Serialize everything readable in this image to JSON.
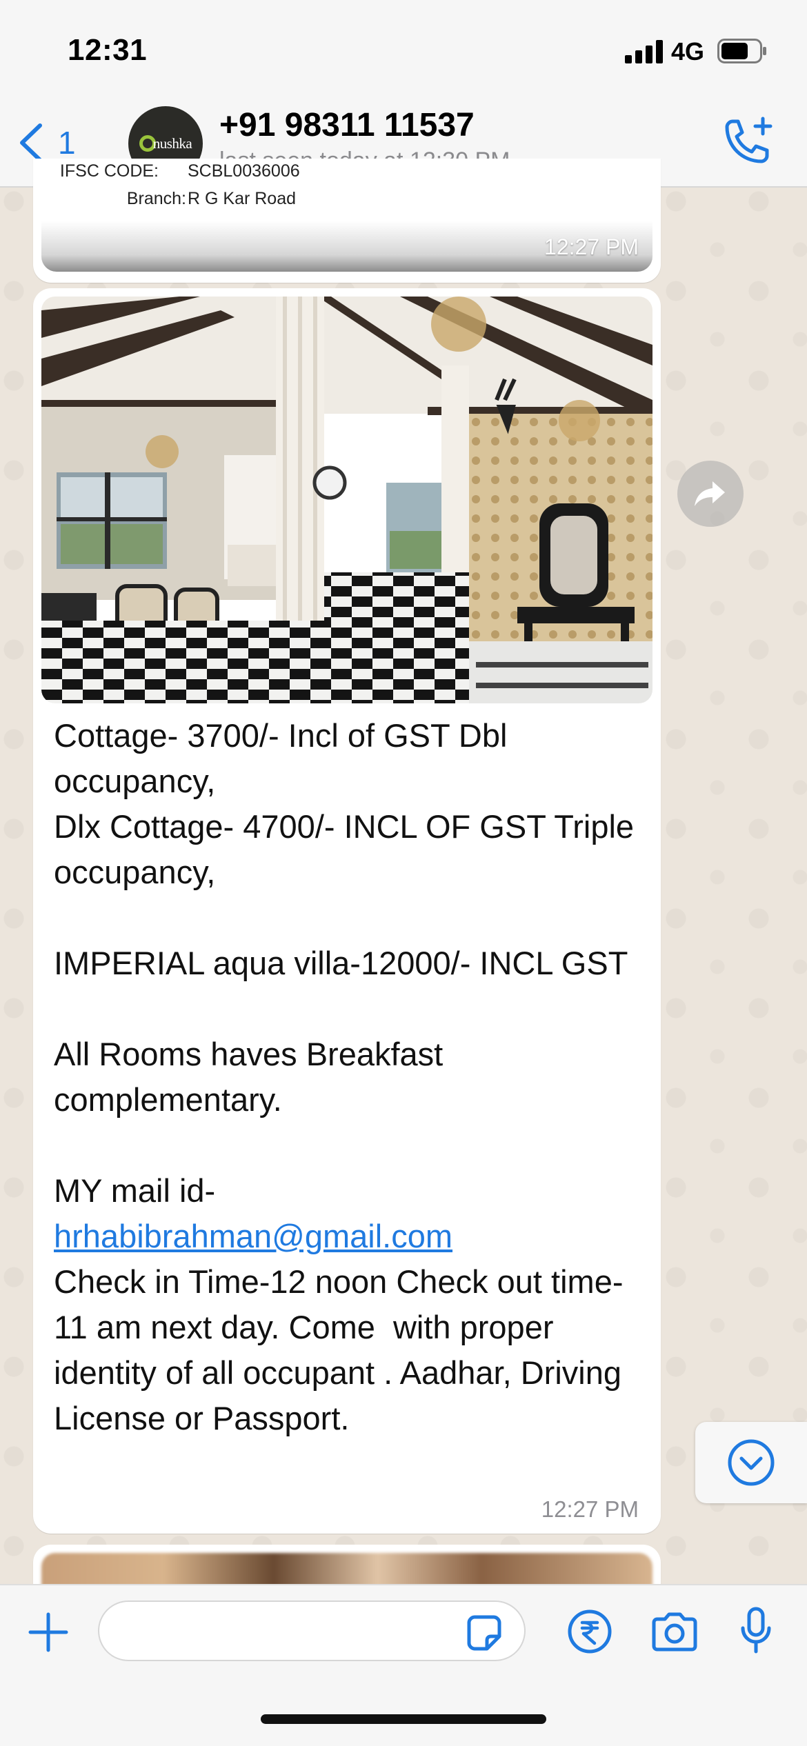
{
  "status_bar": {
    "time": "12:31",
    "network": "4G"
  },
  "header": {
    "back_count": "1",
    "contact_name": "+91 98311 11537",
    "last_seen": "last seen today at 12:30 PM",
    "avatar_text": "nushka"
  },
  "messages": {
    "doc_message": {
      "rows": [
        {
          "label": "IFSC CODE:",
          "value": "SCBL0036006"
        },
        {
          "label": "Branch:",
          "value": "R G Kar Road"
        }
      ],
      "time": "12:27 PM"
    },
    "main_message": {
      "text_part1": "Cottage- 3700/- Incl of GST Dbl occupancy,\nDlx Cottage- 4700/- INCL OF GST Triple occupancy,\n\nIMPERIAL aqua villa-12000/- INCL GST\n\nAll Rooms haves Breakfast complementary.\n\nMY mail id-\n",
      "email": "hrhabibrahman@gmail.com",
      "text_part2": "\nCheck in Time-12 noon Check out time-11 am next day. Come  with proper identity of all occupant . Aadhar, Driving License or Passport.",
      "time": "12:27 PM"
    }
  },
  "icons": {
    "back": "chevron-left-icon",
    "call": "phone-plus-icon",
    "forward": "forward-icon",
    "scroll_down": "chevron-down-circle-icon",
    "plus": "plus-icon",
    "sticker": "sticker-icon",
    "payment": "rupee-icon",
    "camera": "camera-icon",
    "mic": "mic-icon"
  },
  "colors": {
    "accent": "#1f7ae0",
    "bubble": "#ffffff",
    "wallpaper": "#ece5dc"
  }
}
